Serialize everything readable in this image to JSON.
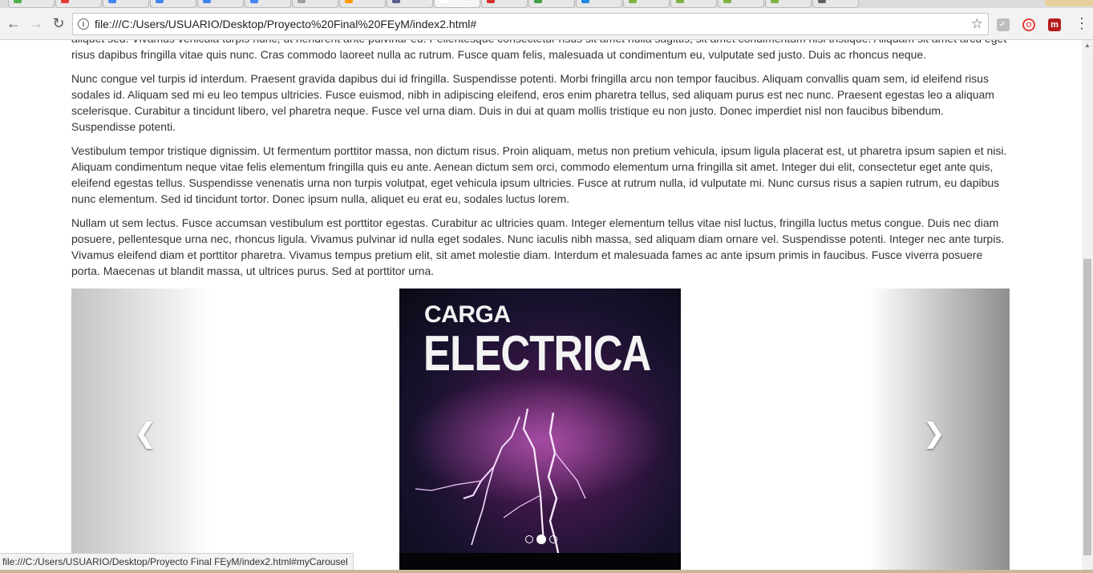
{
  "browser": {
    "url": "file:///C:/Users/USUARIO/Desktop/Proyecto%20Final%20FEyM/index2.html#",
    "status_url": "file:///C:/Users/USUARIO/Desktop/Proyecto Final FEyM/index2.html#myCarousel",
    "tabs": [
      {
        "favicon_color": "#4caf50"
      },
      {
        "favicon_color": "#e53935"
      },
      {
        "favicon_color": "#4285f4"
      },
      {
        "favicon_color": "#4285f4"
      },
      {
        "favicon_color": "#4285f4"
      },
      {
        "favicon_color": "#4285f4"
      },
      {
        "favicon_color": "#9e9e9e"
      },
      {
        "favicon_color": "#ff9800"
      },
      {
        "favicon_color": "#5c5c8a"
      },
      {
        "favicon_color": "#ffffff",
        "active": true
      },
      {
        "favicon_color": "#d32f2f"
      },
      {
        "favicon_color": "#43a047"
      },
      {
        "favicon_color": "#1e88e5"
      },
      {
        "favicon_color": "#7cb342"
      },
      {
        "favicon_color": "#7cb342"
      },
      {
        "favicon_color": "#7cb342"
      },
      {
        "favicon_color": "#7cb342"
      },
      {
        "favicon_color": "#616161"
      }
    ]
  },
  "content": {
    "paragraphs": [
      "aliquet sed. Vivamus vehicula turpis nunc, ut hendrerit ante pulvinar eu. Pellentesque consectetur risus sit amet nulla sagittis, sit amet condimentum nisl tristique. Aliquam sit amet arcu eget risus dapibus fringilla vitae quis nunc. Cras commodo laoreet nulla ac rutrum. Fusce quam felis, malesuada ut condimentum eu, vulputate sed justo. Duis ac rhoncus neque.",
      "Nunc congue vel turpis id interdum. Praesent gravida dapibus dui id fringilla. Suspendisse potenti. Morbi fringilla arcu non tempor faucibus. Aliquam convallis quam sem, id eleifend risus sodales id. Aliquam sed mi eu leo tempus ultricies. Fusce euismod, nibh in adipiscing eleifend, eros enim pharetra tellus, sed aliquam purus est nec nunc. Praesent egestas leo a aliquam scelerisque. Curabitur a tincidunt libero, vel pharetra neque. Fusce vel urna diam. Duis in dui at quam mollis tristique eu non justo. Donec imperdiet nisl non faucibus bibendum. Suspendisse potenti.",
      "Vestibulum tempor tristique dignissim. Ut fermentum porttitor massa, non dictum risus. Proin aliquam, metus non pretium vehicula, ipsum ligula placerat est, ut pharetra ipsum sapien et nisi. Aliquam condimentum neque vitae felis elementum fringilla quis eu ante. Aenean dictum sem orci, commodo elementum urna fringilla sit amet. Integer dui elit, consectetur eget ante quis, eleifend egestas tellus. Suspendisse venenatis urna non turpis volutpat, eget vehicula ipsum ultricies. Fusce at rutrum nulla, id vulputate mi. Nunc cursus risus a sapien rutrum, eu dapibus nunc elementum. Sed id tincidunt tortor. Donec ipsum nulla, aliquet eu erat eu, sodales luctus lorem.",
      "Nullam ut sem lectus. Fusce accumsan vestibulum est porttitor egestas. Curabitur ac ultricies quam. Integer elementum tellus vitae nisl luctus, fringilla luctus metus congue. Duis nec diam posuere, pellentesque urna nec, rhoncus ligula. Vivamus pulvinar id nulla eget sodales. Nunc iaculis nibh massa, sed aliquam diam ornare vel. Suspendisse potenti. Integer nec ante turpis. Vivamus eleifend diam et porttitor pharetra. Vivamus tempus pretium elit, sit amet molestie diam. Interdum et malesuada fames ac ante ipsum primis in faucibus. Fusce viverra posuere porta. Maecenas ut blandit massa, ut ultrices purus. Sed at porttitor urna."
    ]
  },
  "carousel": {
    "slide_title_small": "CARGA",
    "slide_title_large": "ELECTRICA",
    "prev_icon": "chevron-left-icon",
    "next_icon": "chevron-right-icon",
    "indicator_count": 3,
    "active_indicator": 2
  },
  "colors": {
    "text": "#333333",
    "chrome_toolbar": "#f2f2f2",
    "lightning": "#f2c8ff",
    "storm_purple": "#6e2a6a"
  }
}
